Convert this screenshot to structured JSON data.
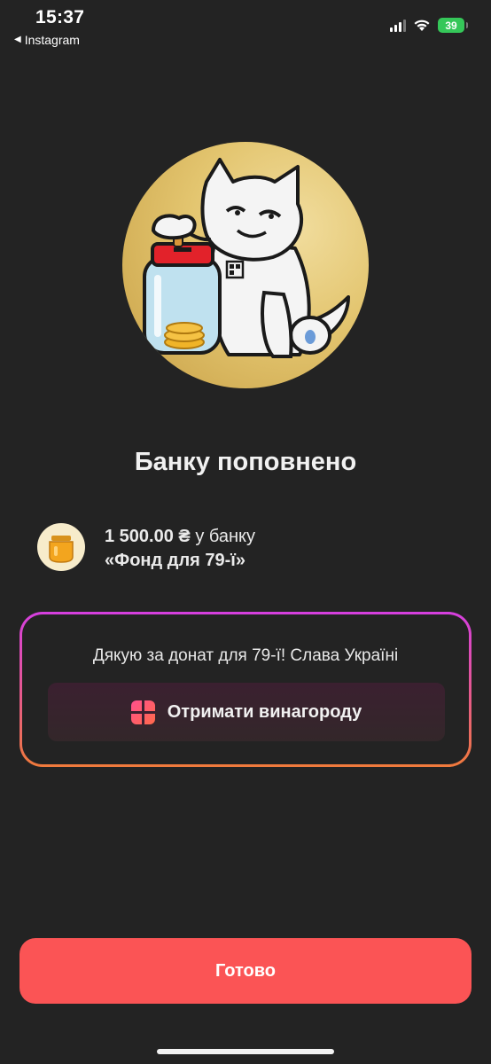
{
  "status_bar": {
    "time": "15:37",
    "back_app": "Instagram",
    "back_icon": "back-triangle-icon",
    "battery": "39",
    "battery_color": "#35c759"
  },
  "hero": {
    "illustration": "cat-with-coin-jar-illustration"
  },
  "title": "Банку поповнено",
  "donation": {
    "amount": "1 500.00 ₴",
    "amount_suffix": "у банку",
    "jar_name": "«Фонд для 79-ї»",
    "icon": "honey-jar-icon"
  },
  "message_card": {
    "text": "Дякую за донат для 79-ї! Слава Україні",
    "reward_button_label": "Отримати винагороду",
    "reward_icon": "gift-icon",
    "border_gradient": [
      "#d63fe0",
      "#f07a3c"
    ]
  },
  "done_button": {
    "label": "Готово",
    "color": "#fb5455"
  },
  "colors": {
    "background": "#232323",
    "hero_bg": "#e3c56f"
  }
}
